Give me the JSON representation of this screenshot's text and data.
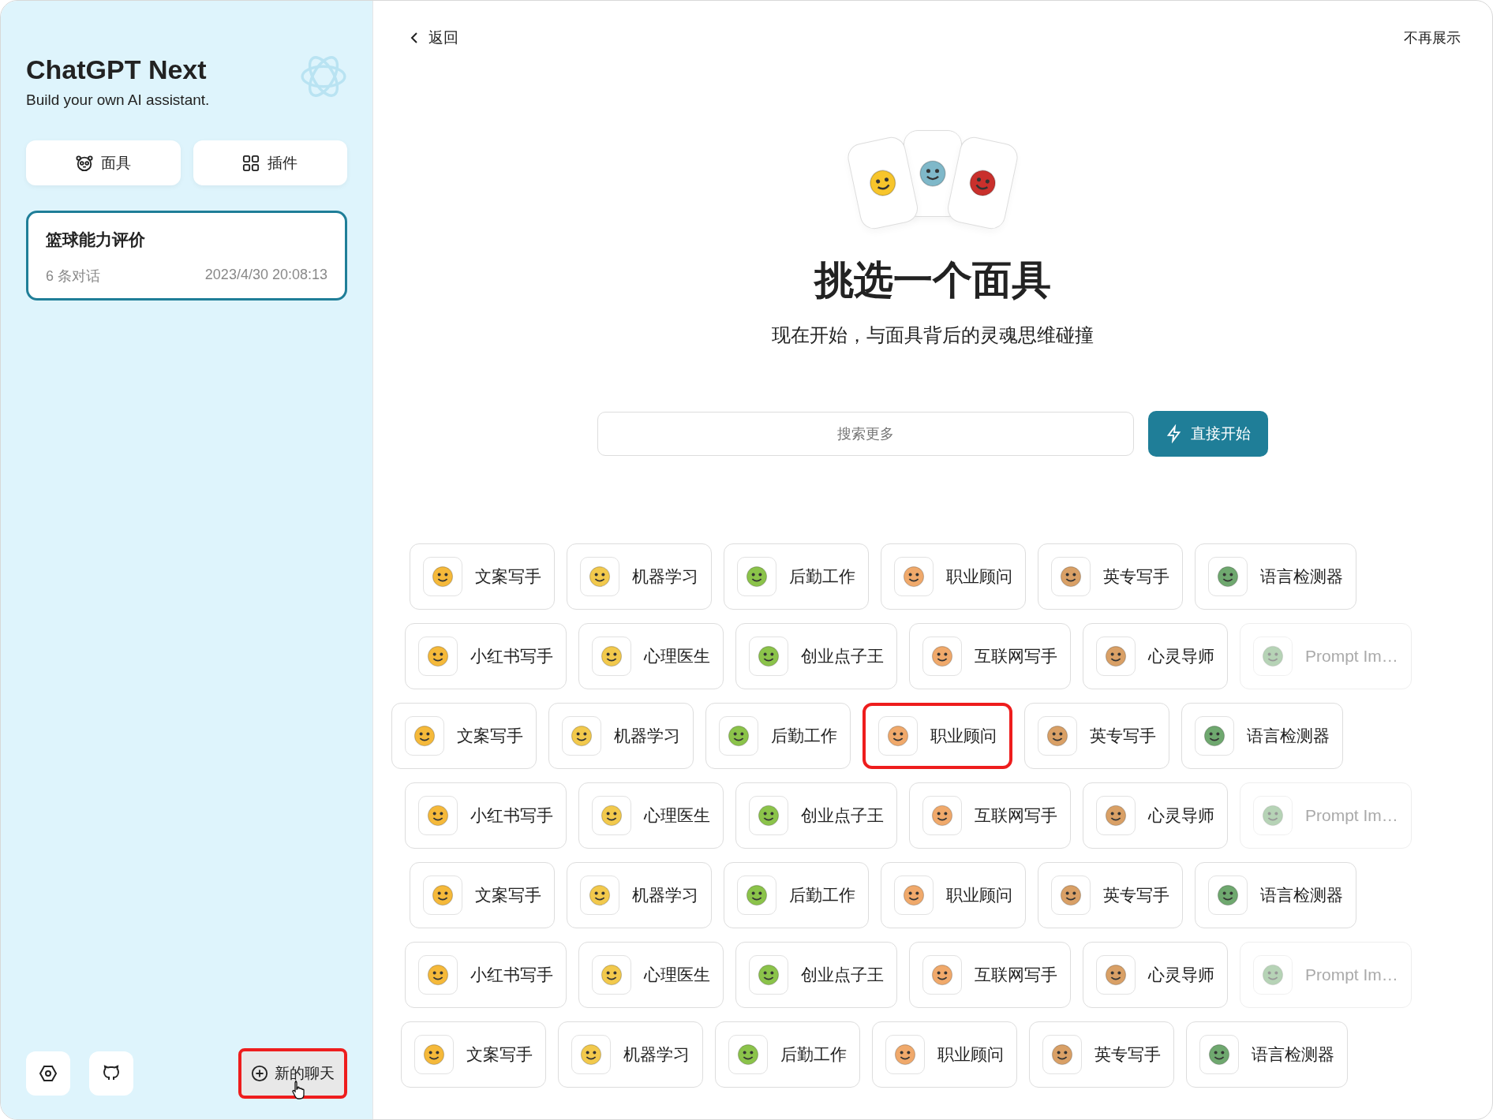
{
  "sidebar": {
    "title": "ChatGPT Next",
    "subtitle": "Build your own AI assistant.",
    "buttons": [
      {
        "label": "面具"
      },
      {
        "label": "插件"
      }
    ],
    "chats": [
      {
        "title": "篮球能力评价",
        "count": "6 条对话",
        "time": "2023/4/30 20:08:13",
        "selected": true
      }
    ],
    "new_chat": {
      "label": "新的聊天",
      "highlighted": true
    }
  },
  "header": {
    "back": "返回",
    "dismiss": "不再展示"
  },
  "hero": {
    "title": "挑选一个面具",
    "subtitle": "现在开始，与面具背后的灵魂思维碰撞"
  },
  "search": {
    "placeholder": "搜索更多"
  },
  "start_button": "直接开始",
  "mask_rows": [
    {
      "masks": [
        {
          "name": "文案写手",
          "highlighted": false,
          "faded": false
        },
        {
          "name": "机器学习",
          "highlighted": false,
          "faded": false
        },
        {
          "name": "后勤工作",
          "highlighted": false,
          "faded": false
        },
        {
          "name": "职业顾问",
          "highlighted": false,
          "faded": false
        },
        {
          "name": "英专写手",
          "highlighted": false,
          "faded": false
        },
        {
          "name": "语言检测器",
          "highlighted": false,
          "faded": false
        }
      ]
    },
    {
      "masks": [
        {
          "name": "小红书写手",
          "highlighted": false,
          "faded": false
        },
        {
          "name": "心理医生",
          "highlighted": false,
          "faded": false
        },
        {
          "name": "创业点子王",
          "highlighted": false,
          "faded": false
        },
        {
          "name": "互联网写手",
          "highlighted": false,
          "faded": false
        },
        {
          "name": "心灵导师",
          "highlighted": false,
          "faded": false
        },
        {
          "name": "Prompt Im…",
          "highlighted": false,
          "faded": true
        }
      ]
    },
    {
      "masks": [
        {
          "name": "文案写手",
          "highlighted": false,
          "faded": false
        },
        {
          "name": "机器学习",
          "highlighted": false,
          "faded": false
        },
        {
          "name": "后勤工作",
          "highlighted": false,
          "faded": false
        },
        {
          "name": "职业顾问",
          "highlighted": true,
          "faded": false
        },
        {
          "name": "英专写手",
          "highlighted": false,
          "faded": false
        },
        {
          "name": "语言检测器",
          "highlighted": false,
          "faded": false
        }
      ]
    },
    {
      "masks": [
        {
          "name": "小红书写手",
          "highlighted": false,
          "faded": false
        },
        {
          "name": "心理医生",
          "highlighted": false,
          "faded": false
        },
        {
          "name": "创业点子王",
          "highlighted": false,
          "faded": false
        },
        {
          "name": "互联网写手",
          "highlighted": false,
          "faded": false
        },
        {
          "name": "心灵导师",
          "highlighted": false,
          "faded": false
        },
        {
          "name": "Prompt Im…",
          "highlighted": false,
          "faded": true
        }
      ]
    },
    {
      "masks": [
        {
          "name": "文案写手",
          "highlighted": false,
          "faded": false
        },
        {
          "name": "机器学习",
          "highlighted": false,
          "faded": false
        },
        {
          "name": "后勤工作",
          "highlighted": false,
          "faded": false
        },
        {
          "name": "职业顾问",
          "highlighted": false,
          "faded": false
        },
        {
          "name": "英专写手",
          "highlighted": false,
          "faded": false
        },
        {
          "name": "语言检测器",
          "highlighted": false,
          "faded": false
        }
      ]
    },
    {
      "masks": [
        {
          "name": "小红书写手",
          "highlighted": false,
          "faded": false
        },
        {
          "name": "心理医生",
          "highlighted": false,
          "faded": false
        },
        {
          "name": "创业点子王",
          "highlighted": false,
          "faded": false
        },
        {
          "name": "互联网写手",
          "highlighted": false,
          "faded": false
        },
        {
          "name": "心灵导师",
          "highlighted": false,
          "faded": false
        },
        {
          "name": "Prompt Im…",
          "highlighted": false,
          "faded": true
        }
      ]
    },
    {
      "masks": [
        {
          "name": "文案写手",
          "highlighted": false,
          "faded": false
        },
        {
          "name": "机器学习",
          "highlighted": false,
          "faded": false
        },
        {
          "name": "后勤工作",
          "highlighted": false,
          "faded": false
        },
        {
          "name": "职业顾问",
          "highlighted": false,
          "faded": false
        },
        {
          "name": "英专写手",
          "highlighted": false,
          "faded": false
        },
        {
          "name": "语言检测器",
          "highlighted": false,
          "faded": false
        }
      ]
    }
  ]
}
